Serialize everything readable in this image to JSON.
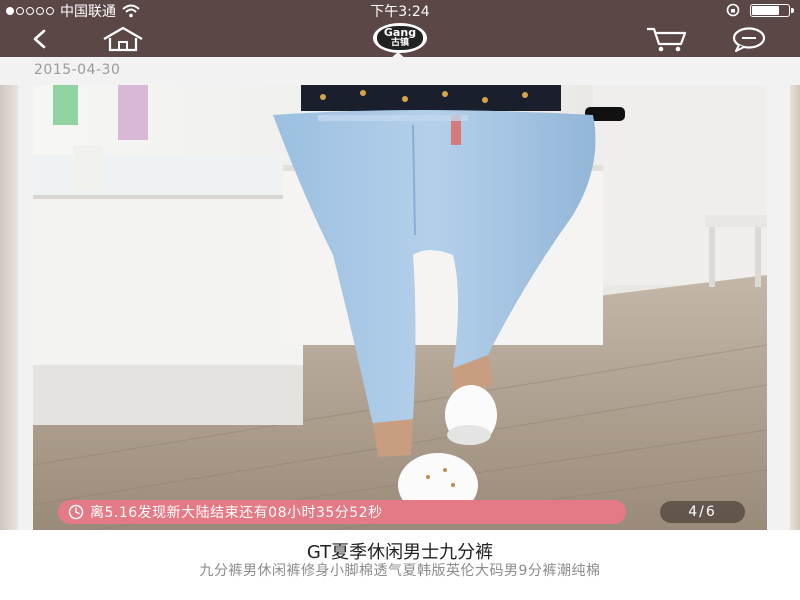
{
  "status_bar": {
    "carrier": "中国联通",
    "time": "下午3:24",
    "signal_filled": 1,
    "signal_total": 5,
    "battery_level": 0.7
  },
  "nav": {
    "logo_en": "Gang",
    "logo_cn": "古镇",
    "back_icon": "chevron-left-icon",
    "home_icon": "home-icon",
    "cart_icon": "cart-icon",
    "chat_icon": "chat-bubble-icon"
  },
  "post": {
    "date": "2015-04-30",
    "countdown_text": "离5.16发现新大陆结束还有08小时35分52秒",
    "image_counter": "4/6",
    "title": "GT夏季休闲男士九分裤",
    "description": "九分裤男休闲裤修身小脚棉透气夏韩版英伦大码男9分裤潮纯棉"
  },
  "colors": {
    "header_bg": "#5c4747",
    "countdown_bg": "#e47a86",
    "jeans": "#a9c8e4"
  }
}
